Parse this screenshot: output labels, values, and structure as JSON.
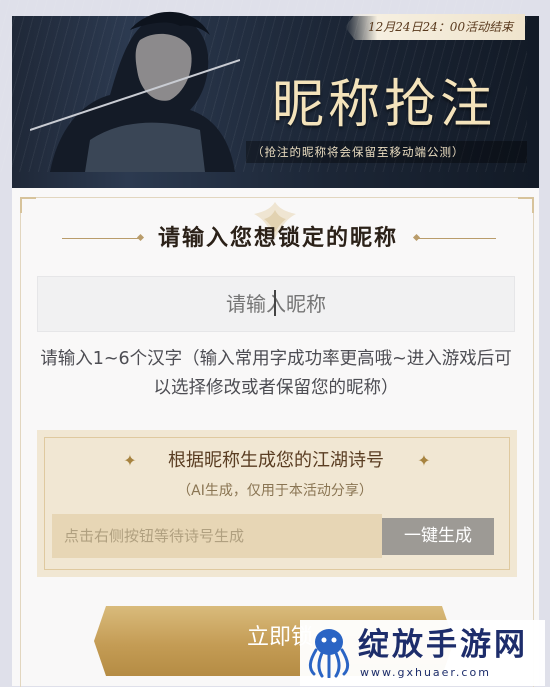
{
  "banner": {
    "event_end": "12月24日24：00活动结束",
    "title": "昵称抢注",
    "subtitle": "（抢注的昵称将会保留至移动端公测）"
  },
  "form": {
    "heading": "请输入您想锁定的昵称",
    "nickname_placeholder": "请输入昵称",
    "nickname_value": "",
    "hint": "请输入1~6个汉字（输入常用字成功率更高哦~进入游戏后可以选择修改或者保留您的昵称）"
  },
  "poem": {
    "title": "根据昵称生成您的江湖诗号",
    "star_icon": "✦",
    "subtitle": "（AI生成，仅用于本活动分享）",
    "field_placeholder": "点击右侧按钮等待诗号生成",
    "generate_label": "一键生成"
  },
  "lock_button": {
    "label": "立即锁"
  },
  "watermark": {
    "brand": "绽放手游网",
    "url": "www.gxhuaer.com"
  },
  "colors": {
    "accent_gold": "#c49c55",
    "title_gold": "#f4e3bb",
    "heading_text": "#2b2118",
    "button_gray": "#9d9a95",
    "watermark_blue": "#1d2d6b"
  }
}
